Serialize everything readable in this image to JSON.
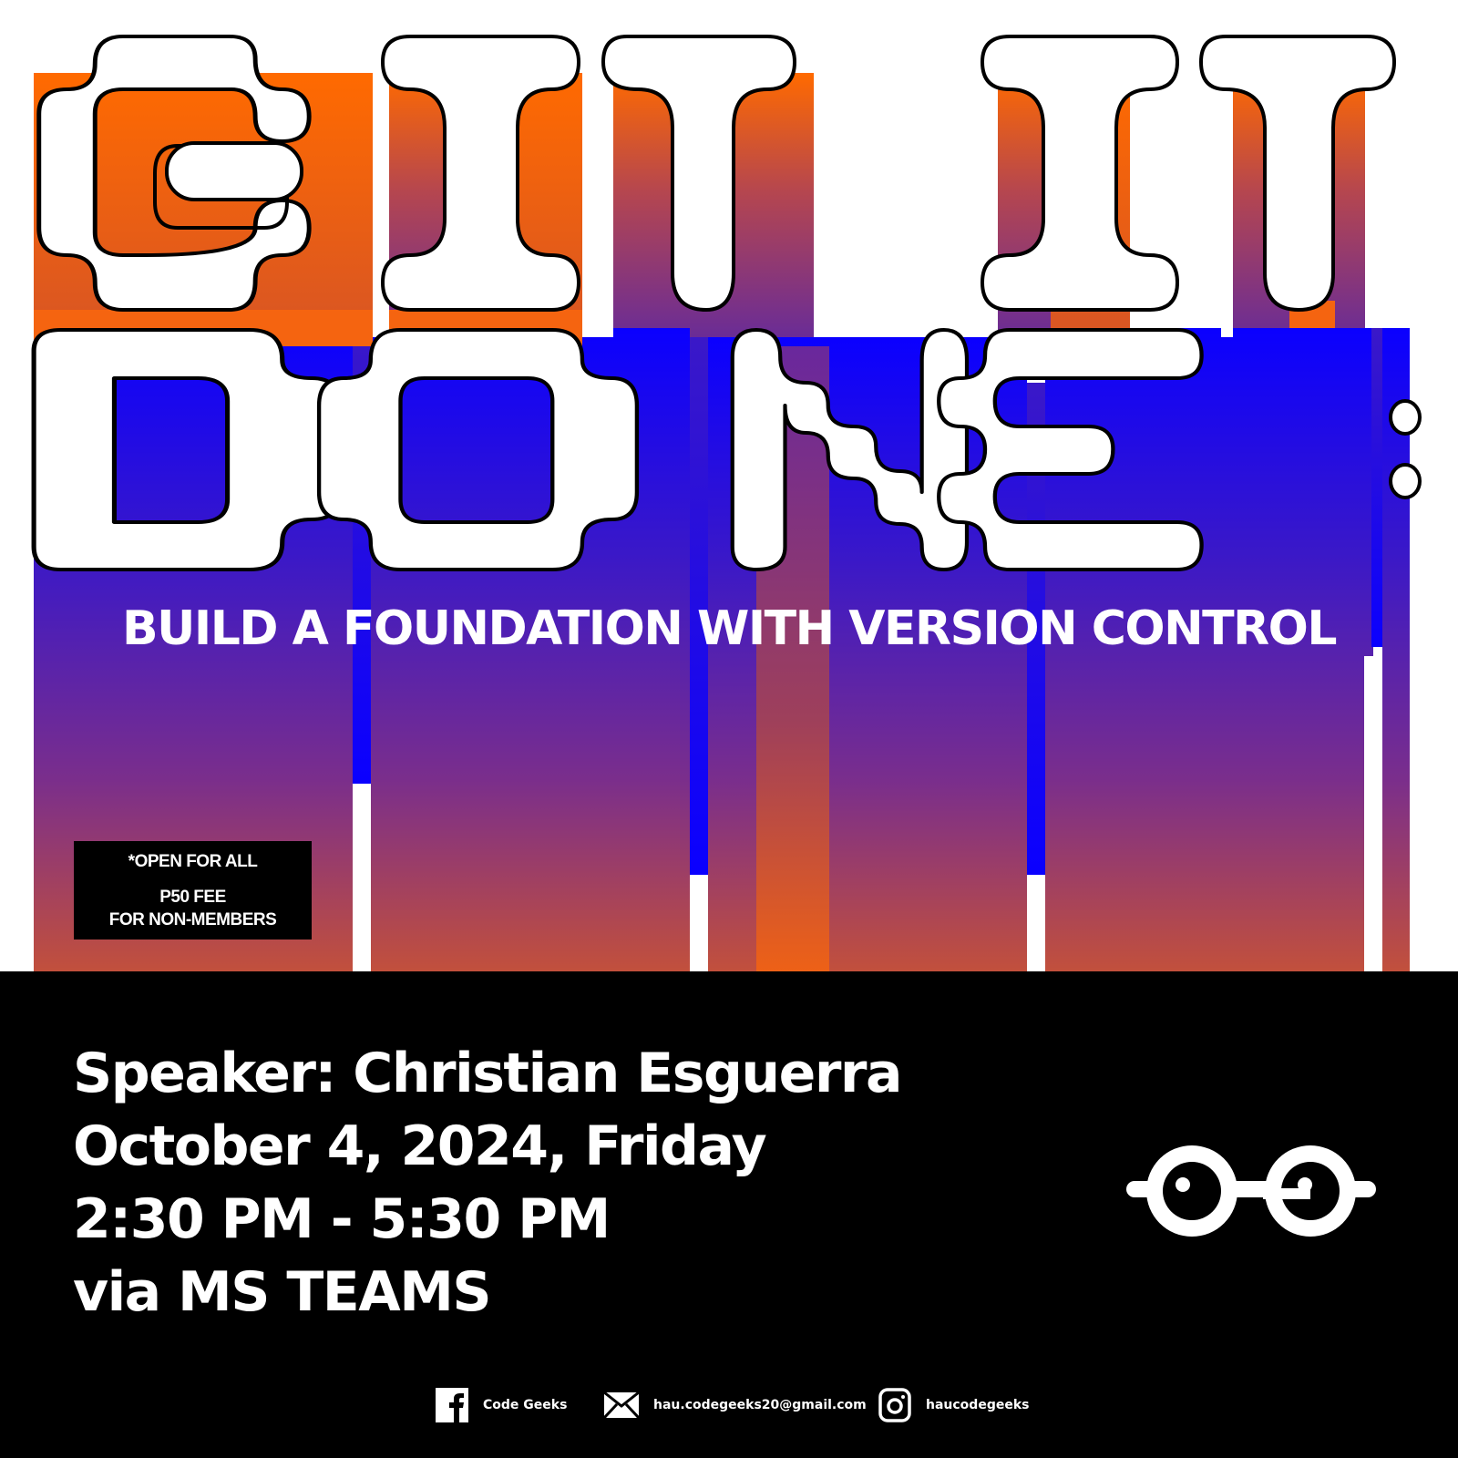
{
  "poster": {
    "headline_line1": "GIT IT",
    "headline_line2": "DONE:",
    "subtitle": "BUILD A FOUNDATION WITH VERSION CONTROL",
    "notice": {
      "line1": "*OPEN FOR ALL",
      "line2": "P50 FEE",
      "line3": "FOR NON-MEMBERS"
    },
    "details": {
      "speaker": "Speaker: Christian Esguerra",
      "date": "October 4, 2024, Friday",
      "time": "2:30 PM - 5:30 PM",
      "venue": "via MS TEAMS"
    },
    "logo_icon": "code-geeks-glasses-logo",
    "footer": {
      "facebook": {
        "icon": "facebook-icon",
        "label": "Code Geeks"
      },
      "email": {
        "icon": "mail-icon",
        "label": "hau.codegeeks20@gmail.com"
      },
      "instagram": {
        "icon": "instagram-icon",
        "label": "haucodegeeks"
      }
    },
    "colors": {
      "orange": "#FF6A00",
      "blue": "#0A00FF",
      "purple": "#7A2E8C",
      "black": "#000000",
      "white": "#FFFFFF"
    }
  }
}
